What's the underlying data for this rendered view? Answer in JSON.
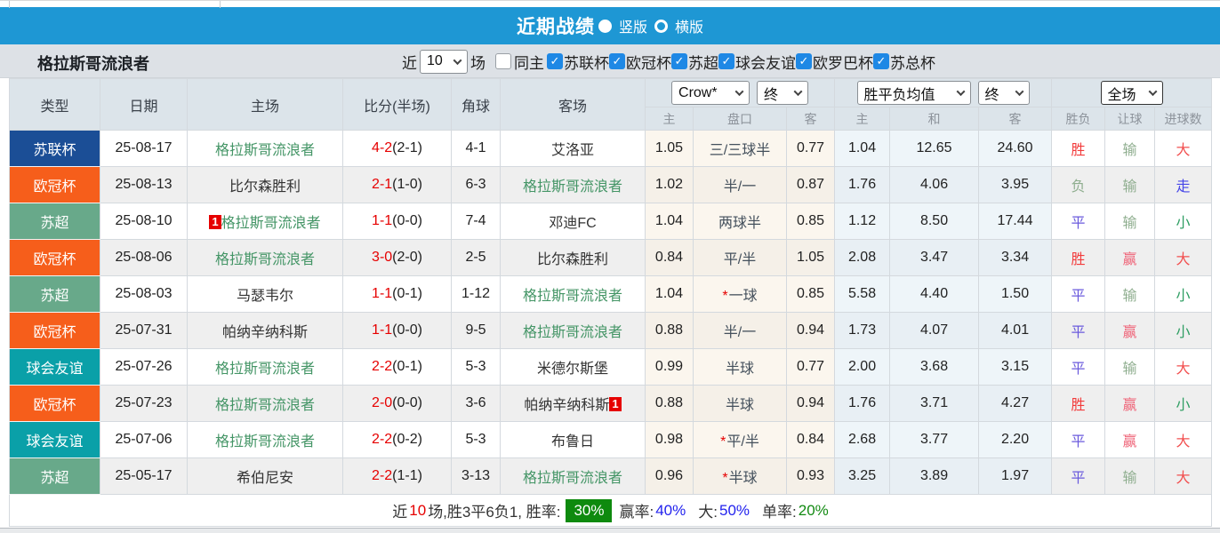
{
  "title_bar": {
    "title": "近期战绩",
    "radio_selected_label": "竖版",
    "radio_unselected_label": "横版"
  },
  "filter_bar": {
    "team_name": "格拉斯哥流浪者",
    "near_label": "近",
    "matches_select_value": "10",
    "matches_label": "场",
    "same_host_label": "同主",
    "leagues": [
      {
        "label": "苏联杯",
        "checked": true
      },
      {
        "label": "欧冠杯",
        "checked": true
      },
      {
        "label": "苏超",
        "checked": true
      },
      {
        "label": "球会友谊",
        "checked": true
      },
      {
        "label": "欧罗巴杯",
        "checked": true
      },
      {
        "label": "苏总杯",
        "checked": true
      }
    ]
  },
  "table": {
    "main_headers": [
      "类型",
      "日期",
      "主场",
      "比分(半场)",
      "角球",
      "客场"
    ],
    "controls": {
      "odds_company": "Crow*",
      "odds_company_state": "终",
      "avg_label": "胜平负均值",
      "avg_state": "终",
      "scope": "全场"
    },
    "sub_headers": [
      "主",
      "盘口",
      "客",
      "主",
      "和",
      "客",
      "胜负",
      "让球",
      "进球数"
    ],
    "rows": [
      {
        "league": "苏联杯",
        "league_color": "#1b4e96",
        "date": "25-08-17",
        "home": {
          "name": "格拉斯哥流浪者",
          "highlight": true,
          "rank_badge": false
        },
        "score": "4-2",
        "half": "(2-1)",
        "corner": "4-1",
        "away": {
          "name": "艾洛亚",
          "highlight": false,
          "rank_badge": false
        },
        "odds": {
          "home": "1.05",
          "handicap": "三/三球半",
          "star": false,
          "away": "0.77"
        },
        "avg": {
          "home": "1.04",
          "draw": "12.65",
          "away": "24.60"
        },
        "result": {
          "text": "胜",
          "type": "win"
        },
        "rangqiu": {
          "text": "输",
          "type": "lose"
        },
        "goals": {
          "text": "大",
          "type": "big"
        }
      },
      {
        "league": "欧冠杯",
        "league_color": "#f65e1b",
        "date": "25-08-13",
        "home": {
          "name": "比尔森胜利",
          "highlight": false,
          "rank_badge": false
        },
        "score": "2-1",
        "half": "(1-0)",
        "corner": "6-3",
        "away": {
          "name": "格拉斯哥流浪者",
          "highlight": true,
          "rank_badge": false
        },
        "odds": {
          "home": "1.02",
          "handicap": "半/一",
          "star": false,
          "away": "0.87"
        },
        "avg": {
          "home": "1.76",
          "draw": "4.06",
          "away": "3.95"
        },
        "result": {
          "text": "负",
          "type": "lose"
        },
        "rangqiu": {
          "text": "输",
          "type": "lose"
        },
        "goals": {
          "text": "走",
          "type": "push"
        }
      },
      {
        "league": "苏超",
        "league_color": "#68a98a",
        "date": "25-08-10",
        "home": {
          "name": "格拉斯哥流浪者",
          "highlight": true,
          "rank_badge": true
        },
        "score": "1-1",
        "half": "(0-0)",
        "corner": "7-4",
        "away": {
          "name": "邓迪FC",
          "highlight": false,
          "rank_badge": false
        },
        "odds": {
          "home": "1.04",
          "handicap": "两球半",
          "star": false,
          "away": "0.85"
        },
        "avg": {
          "home": "1.12",
          "draw": "8.50",
          "away": "17.44"
        },
        "result": {
          "text": "平",
          "type": "draw"
        },
        "rangqiu": {
          "text": "输",
          "type": "lose"
        },
        "goals": {
          "text": "小",
          "type": "small"
        }
      },
      {
        "league": "欧冠杯",
        "league_color": "#f65e1b",
        "date": "25-08-06",
        "home": {
          "name": "格拉斯哥流浪者",
          "highlight": true,
          "rank_badge": false
        },
        "score": "3-0",
        "half": "(2-0)",
        "corner": "2-5",
        "away": {
          "name": "比尔森胜利",
          "highlight": false,
          "rank_badge": false
        },
        "odds": {
          "home": "0.84",
          "handicap": "平/半",
          "star": false,
          "away": "1.05"
        },
        "avg": {
          "home": "2.08",
          "draw": "3.47",
          "away": "3.34"
        },
        "result": {
          "text": "胜",
          "type": "win"
        },
        "rangqiu": {
          "text": "赢",
          "type": "win"
        },
        "goals": {
          "text": "大",
          "type": "big"
        }
      },
      {
        "league": "苏超",
        "league_color": "#68a98a",
        "date": "25-08-03",
        "home": {
          "name": "马瑟韦尔",
          "highlight": false,
          "rank_badge": false
        },
        "score": "1-1",
        "half": "(0-1)",
        "corner": "1-12",
        "away": {
          "name": "格拉斯哥流浪者",
          "highlight": true,
          "rank_badge": false
        },
        "odds": {
          "home": "1.04",
          "handicap": "一球",
          "star": true,
          "away": "0.85"
        },
        "avg": {
          "home": "5.58",
          "draw": "4.40",
          "away": "1.50"
        },
        "result": {
          "text": "平",
          "type": "draw"
        },
        "rangqiu": {
          "text": "输",
          "type": "lose"
        },
        "goals": {
          "text": "小",
          "type": "small"
        }
      },
      {
        "league": "欧冠杯",
        "league_color": "#f65e1b",
        "date": "25-07-31",
        "home": {
          "name": "帕纳辛纳科斯",
          "highlight": false,
          "rank_badge": false
        },
        "score": "1-1",
        "half": "(0-0)",
        "corner": "9-5",
        "away": {
          "name": "格拉斯哥流浪者",
          "highlight": true,
          "rank_badge": false
        },
        "odds": {
          "home": "0.88",
          "handicap": "半/一",
          "star": false,
          "away": "0.94"
        },
        "avg": {
          "home": "1.73",
          "draw": "4.07",
          "away": "4.01"
        },
        "result": {
          "text": "平",
          "type": "draw"
        },
        "rangqiu": {
          "text": "赢",
          "type": "win"
        },
        "goals": {
          "text": "小",
          "type": "small"
        }
      },
      {
        "league": "球会友谊",
        "league_color": "#0aa0a8",
        "date": "25-07-26",
        "home": {
          "name": "格拉斯哥流浪者",
          "highlight": true,
          "rank_badge": false
        },
        "score": "2-2",
        "half": "(0-1)",
        "corner": "5-3",
        "away": {
          "name": "米德尔斯堡",
          "highlight": false,
          "rank_badge": false
        },
        "odds": {
          "home": "0.99",
          "handicap": "半球",
          "star": false,
          "away": "0.77"
        },
        "avg": {
          "home": "2.00",
          "draw": "3.68",
          "away": "3.15"
        },
        "result": {
          "text": "平",
          "type": "draw"
        },
        "rangqiu": {
          "text": "输",
          "type": "lose"
        },
        "goals": {
          "text": "大",
          "type": "big"
        }
      },
      {
        "league": "欧冠杯",
        "league_color": "#f65e1b",
        "date": "25-07-23",
        "home": {
          "name": "格拉斯哥流浪者",
          "highlight": true,
          "rank_badge": false
        },
        "score": "2-0",
        "half": "(0-0)",
        "corner": "3-6",
        "away": {
          "name": "帕纳辛纳科斯",
          "highlight": false,
          "rank_badge": true
        },
        "odds": {
          "home": "0.88",
          "handicap": "半球",
          "star": false,
          "away": "0.94"
        },
        "avg": {
          "home": "1.76",
          "draw": "3.71",
          "away": "4.27"
        },
        "result": {
          "text": "胜",
          "type": "win"
        },
        "rangqiu": {
          "text": "赢",
          "type": "win"
        },
        "goals": {
          "text": "小",
          "type": "small"
        }
      },
      {
        "league": "球会友谊",
        "league_color": "#0aa0a8",
        "date": "25-07-06",
        "home": {
          "name": "格拉斯哥流浪者",
          "highlight": true,
          "rank_badge": false
        },
        "score": "2-2",
        "half": "(0-2)",
        "corner": "5-3",
        "away": {
          "name": "布鲁日",
          "highlight": false,
          "rank_badge": false
        },
        "odds": {
          "home": "0.98",
          "handicap": "平/半",
          "star": true,
          "away": "0.84"
        },
        "avg": {
          "home": "2.68",
          "draw": "3.77",
          "away": "2.20"
        },
        "result": {
          "text": "平",
          "type": "draw"
        },
        "rangqiu": {
          "text": "赢",
          "type": "win"
        },
        "goals": {
          "text": "大",
          "type": "big"
        }
      },
      {
        "league": "苏超",
        "league_color": "#68a98a",
        "date": "25-05-17",
        "home": {
          "name": "希伯尼安",
          "highlight": false,
          "rank_badge": false
        },
        "score": "2-2",
        "half": "(1-1)",
        "corner": "3-13",
        "away": {
          "name": "格拉斯哥流浪者",
          "highlight": true,
          "rank_badge": false
        },
        "odds": {
          "home": "0.96",
          "handicap": "半球",
          "star": true,
          "away": "0.93"
        },
        "avg": {
          "home": "3.25",
          "draw": "3.89",
          "away": "1.97"
        },
        "result": {
          "text": "平",
          "type": "draw"
        },
        "rangqiu": {
          "text": "输",
          "type": "lose"
        },
        "goals": {
          "text": "大",
          "type": "big"
        }
      }
    ]
  },
  "summary": {
    "near_label": "近",
    "near_count": "10",
    "record_text": "场,胜3平6负1, 胜率:",
    "win_rate": "30%",
    "win_odds_label": "赢率:",
    "win_odds_rate": "40%",
    "big_label": "大:",
    "big_rate": "50%",
    "single_label": "单率:",
    "single_rate": "20%"
  },
  "colors": {
    "title_bar_bg": "#1e97d4",
    "league_su_lian_bei": "#1b4e96",
    "league_ou_guan_bei": "#f65e1b",
    "league_su_chao": "#68a98a",
    "league_qiu_hui_you_yi": "#0aa0a8",
    "team_highlight_green": "#449566",
    "score_red": "#e60000",
    "win_rate_badge_bg": "#0e8a0e"
  }
}
